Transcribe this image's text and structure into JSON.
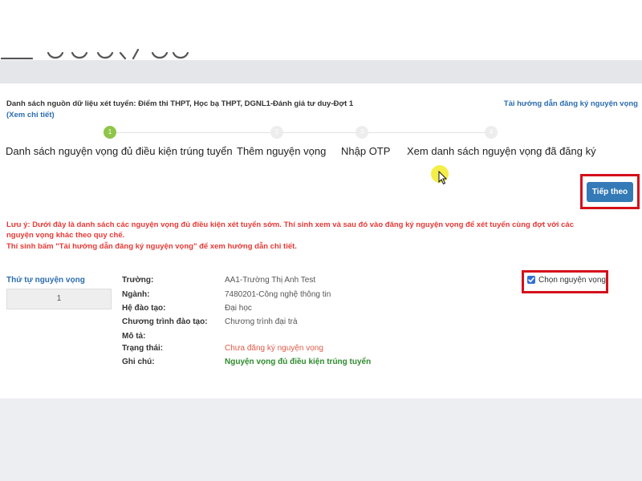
{
  "header": {
    "source_text": "Danh sách nguồn dữ liệu xét tuyển: Điểm thi THPT, Học bạ THPT, DGNL1-Đánh giá tư duy-Đợt 1",
    "detail_link": "(Xem chi tiết)",
    "guide_link": "Tải hướng dẫn đăng ký nguyện vọng"
  },
  "steps": [
    {
      "number": "1",
      "label": "Danh sách nguyện vọng đủ điều kiện trúng tuyển",
      "active": true
    },
    {
      "number": "2",
      "label": "Thêm nguyện vọng",
      "active": false
    },
    {
      "number": "3",
      "label": "Nhập OTP",
      "active": false
    },
    {
      "number": "4",
      "label": "Xem danh sách nguyện vọng đã đăng ký",
      "active": false
    }
  ],
  "next_button": "Tiếp theo",
  "notice": {
    "line1": "Lưu ý: Dưới đây là danh sách các nguyện vọng đủ điều kiện xét tuyển sớm. Thí sinh xem và sau đó vào đăng ký nguyện vọng để xét tuyển cùng đợt với các",
    "line2": "nguyện vọng khác theo quy chế.",
    "line3": "Thí sinh bấm \"Tải hướng dẫn đăng ký nguyện vọng\" để xem hướng dẫn chi tiết."
  },
  "order": {
    "label": "Thứ tự nguyện vọng",
    "value": "1"
  },
  "details": {
    "school_label": "Trường:",
    "school_value": "AA1-Trường Thị Anh Test",
    "major_label": "Ngành:",
    "major_value": "7480201-Công nghệ thông tin",
    "level_label": "Hệ đào tạo:",
    "level_value": "Đại học",
    "program_label": "Chương trình đào tạo:",
    "program_value": "Chương trình đại trà",
    "desc_label": "Mô tả:",
    "status_label": "Trạng thái:",
    "status_value": "Chưa đăng ký nguyện vọng",
    "note_label": "Ghi chú:",
    "note_value": "Nguyện vọng đủ điều kiện trúng tuyển"
  },
  "choose": {
    "label": "Chọn nguyện vọng",
    "checked": true
  },
  "colors": {
    "primary": "#337ab7",
    "highlight_border": "#d4101b",
    "notice": "#e53935",
    "step_active": "#8fc548",
    "success": "#2e8b2e"
  }
}
